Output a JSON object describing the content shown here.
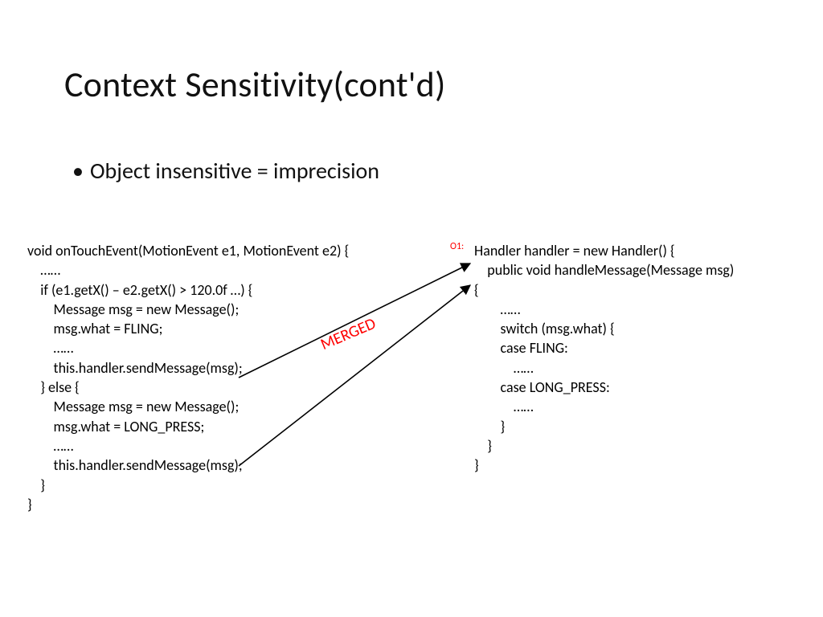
{
  "title": "Context Sensitivity(cont'd)",
  "bullet": "Object insensitive  = imprecision",
  "labels": {
    "o1": "O1:",
    "merged": "MERGED"
  },
  "code_left": "void onTouchEvent(MotionEvent e1, MotionEvent e2) {\n    ……\n    if (e1.getX() – e2.getX() > 120.0f …) {\n        Message msg = new Message();\n        msg.what = FLING;\n        ……\n        this.handler.sendMessage(msg);\n    } else {\n        Message msg = new Message();\n        msg.what = LONG_PRESS;\n        ……\n        this.handler.sendMessage(msg);\n    }\n}",
  "code_right": "Handler handler = new Handler() {\n    public void handleMessage(Message msg) \n{\n        ……\n        switch (msg.what) {\n        case FLING:\n            ……\n        case LONG_PRESS:\n            ……\n        }\n    }\n}"
}
